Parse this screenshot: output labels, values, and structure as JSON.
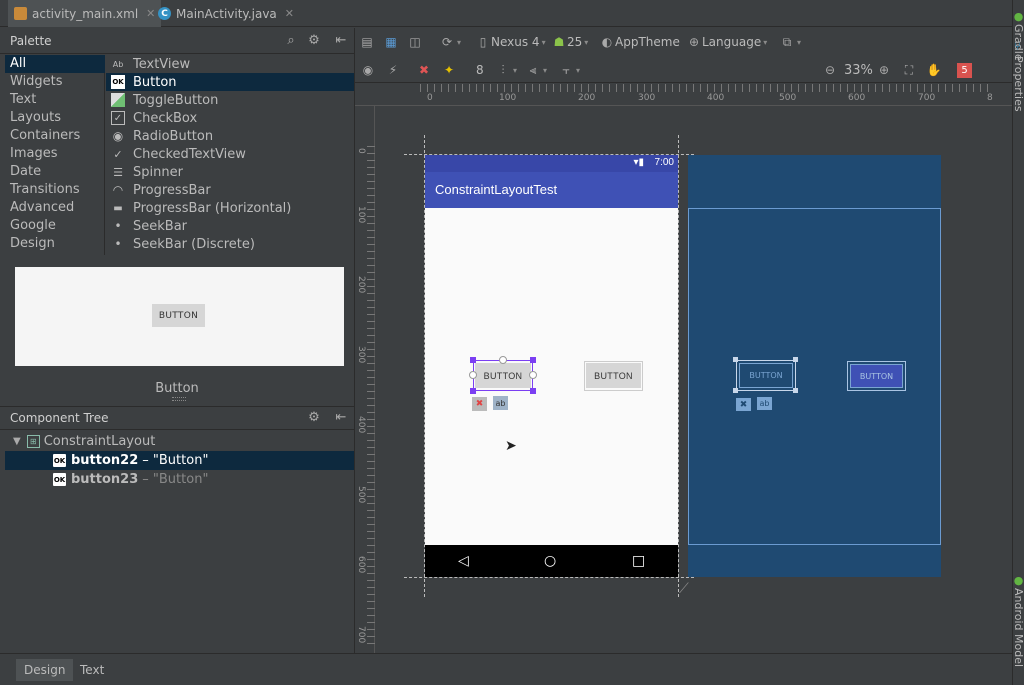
{
  "tabs": [
    {
      "label": "activity_main.xml",
      "icon": "xml-file-icon"
    },
    {
      "label": "MainActivity.java",
      "icon": "java-class-icon"
    }
  ],
  "palette": {
    "title": "Palette",
    "categories": [
      "All",
      "Widgets",
      "Text",
      "Layouts",
      "Containers",
      "Images",
      "Date",
      "Transitions",
      "Advanced",
      "Google",
      "Design"
    ],
    "selected_category": "All",
    "widgets": [
      {
        "label": "TextView",
        "icon": "Ab"
      },
      {
        "label": "Button",
        "icon": "OK"
      },
      {
        "label": "ToggleButton",
        "icon": ""
      },
      {
        "label": "CheckBox",
        "icon": "✓"
      },
      {
        "label": "RadioButton",
        "icon": "◉"
      },
      {
        "label": "CheckedTextView",
        "icon": "✓"
      },
      {
        "label": "Spinner",
        "icon": "☰"
      },
      {
        "label": "ProgressBar",
        "icon": "◠"
      },
      {
        "label": "ProgressBar (Horizontal)",
        "icon": "▬"
      },
      {
        "label": "SeekBar",
        "icon": "•"
      },
      {
        "label": "SeekBar (Discrete)",
        "icon": "•"
      }
    ],
    "selected_widget": "Button",
    "preview_button": "BUTTON",
    "preview_label": "Button"
  },
  "component_tree": {
    "title": "Component Tree",
    "root": "ConstraintLayout",
    "children": [
      {
        "id": "button22",
        "text": "– \"Button\""
      },
      {
        "id": "button23",
        "text": "– \"Button\""
      }
    ]
  },
  "toolbar": {
    "device": "Nexus 4",
    "api": "25",
    "theme": "AppTheme",
    "language": "Language",
    "margin": "8",
    "zoom": "33%",
    "warnings": "5"
  },
  "rulers": {
    "h": [
      "0",
      "100",
      "200",
      "300",
      "400",
      "500",
      "600",
      "700",
      "8"
    ],
    "v": [
      "0",
      "100",
      "200",
      "300",
      "400",
      "500",
      "600",
      "700"
    ]
  },
  "design": {
    "status_time": "7:00",
    "app_title": "ConstraintLayoutTest",
    "button1": "BUTTON",
    "button2": "BUTTON"
  },
  "right_strip": {
    "gradle": "Gradle",
    "properties": "Properties",
    "android_model": "Android Model"
  },
  "bottom_tabs": [
    "Design",
    "Text"
  ]
}
